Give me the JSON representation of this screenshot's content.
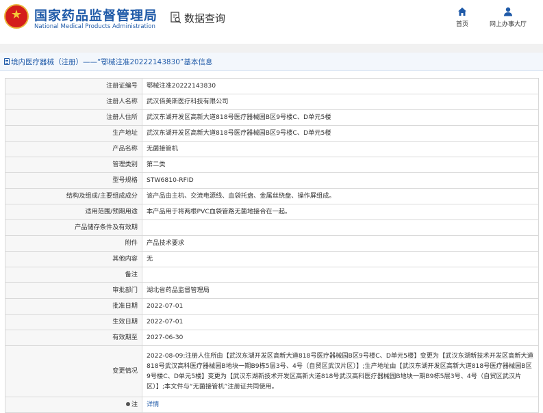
{
  "header": {
    "site_name_cn": "国家药品监督管理局",
    "site_name_en": "National Medical Products Administration",
    "module_label": "数据查询",
    "nav": [
      {
        "label": "首页",
        "icon": "home-icon"
      },
      {
        "label": "网上办事大厅",
        "icon": "user-icon"
      }
    ]
  },
  "breadcrumb": {
    "text": "境内医疗器械（注册）——“鄂械注准20222143830”基本信息"
  },
  "colors": {
    "brand_blue": "#1f5aa8",
    "emblem_red": "#d41d1b",
    "emblem_gold": "#e9b43a"
  },
  "rows": [
    {
      "label": "注册证编号",
      "value": "鄂械注准20222143830"
    },
    {
      "label": "注册人名称",
      "value": "武汉佰美斯医疗科技有限公司"
    },
    {
      "label": "注册人住所",
      "value": "武汉东湖开发区高新大道818号医疗器械园B区9号楼C、D单元5楼"
    },
    {
      "label": "生产地址",
      "value": "武汉东湖开发区高新大道818号医疗器械园B区9号楼C、D单元5楼"
    },
    {
      "label": "产品名称",
      "value": "无菌接管机"
    },
    {
      "label": "管理类别",
      "value": "第二类"
    },
    {
      "label": "型号规格",
      "value": "STW6810-RFID"
    },
    {
      "label": "结构及组成/主要组成成分",
      "value": "该产品由主机、交流电源线、血袋托盘、金属丝绕盘、操作屏组成。"
    },
    {
      "label": "适用范围/预期用途",
      "value": "本产品用于将两根PVC血袋管路无菌地接合在一起。"
    },
    {
      "label": "产品储存条件及有效期",
      "value": ""
    },
    {
      "label": "附件",
      "value": "产品技术要求"
    },
    {
      "label": "其他内容",
      "value": "无"
    },
    {
      "label": "备注",
      "value": ""
    },
    {
      "label": "审批部门",
      "value": "湖北省药品监督管理局"
    },
    {
      "label": "批准日期",
      "value": "2022-07-01"
    },
    {
      "label": "生效日期",
      "value": "2022-07-01"
    },
    {
      "label": "有效期至",
      "value": "2027-06-30"
    },
    {
      "label": "变更情况",
      "value": "2022-08-09:注册人住所由【武汉东湖开发区高新大道818号医疗器械园B区9号楼C、D单元5楼】变更为【武汉东湖新技术开发区高新大道818号武汉高科医疗器械园B地块一期B9栋5层3号、4号（自贸区武汉片区）】;生产地址由【武汉东湖开发区高新大道818号医疗器械园B区9号楼C、D单元5楼】变更为【武汉东湖新技术开发区高新大道818号武汉高科医疗器械园B地块一期B9栋5层3号、4号（自贸区武汉片区）】;本文件与“无菌接管机”注册证共同使用。"
    },
    {
      "label": "注",
      "value": "详情"
    }
  ]
}
